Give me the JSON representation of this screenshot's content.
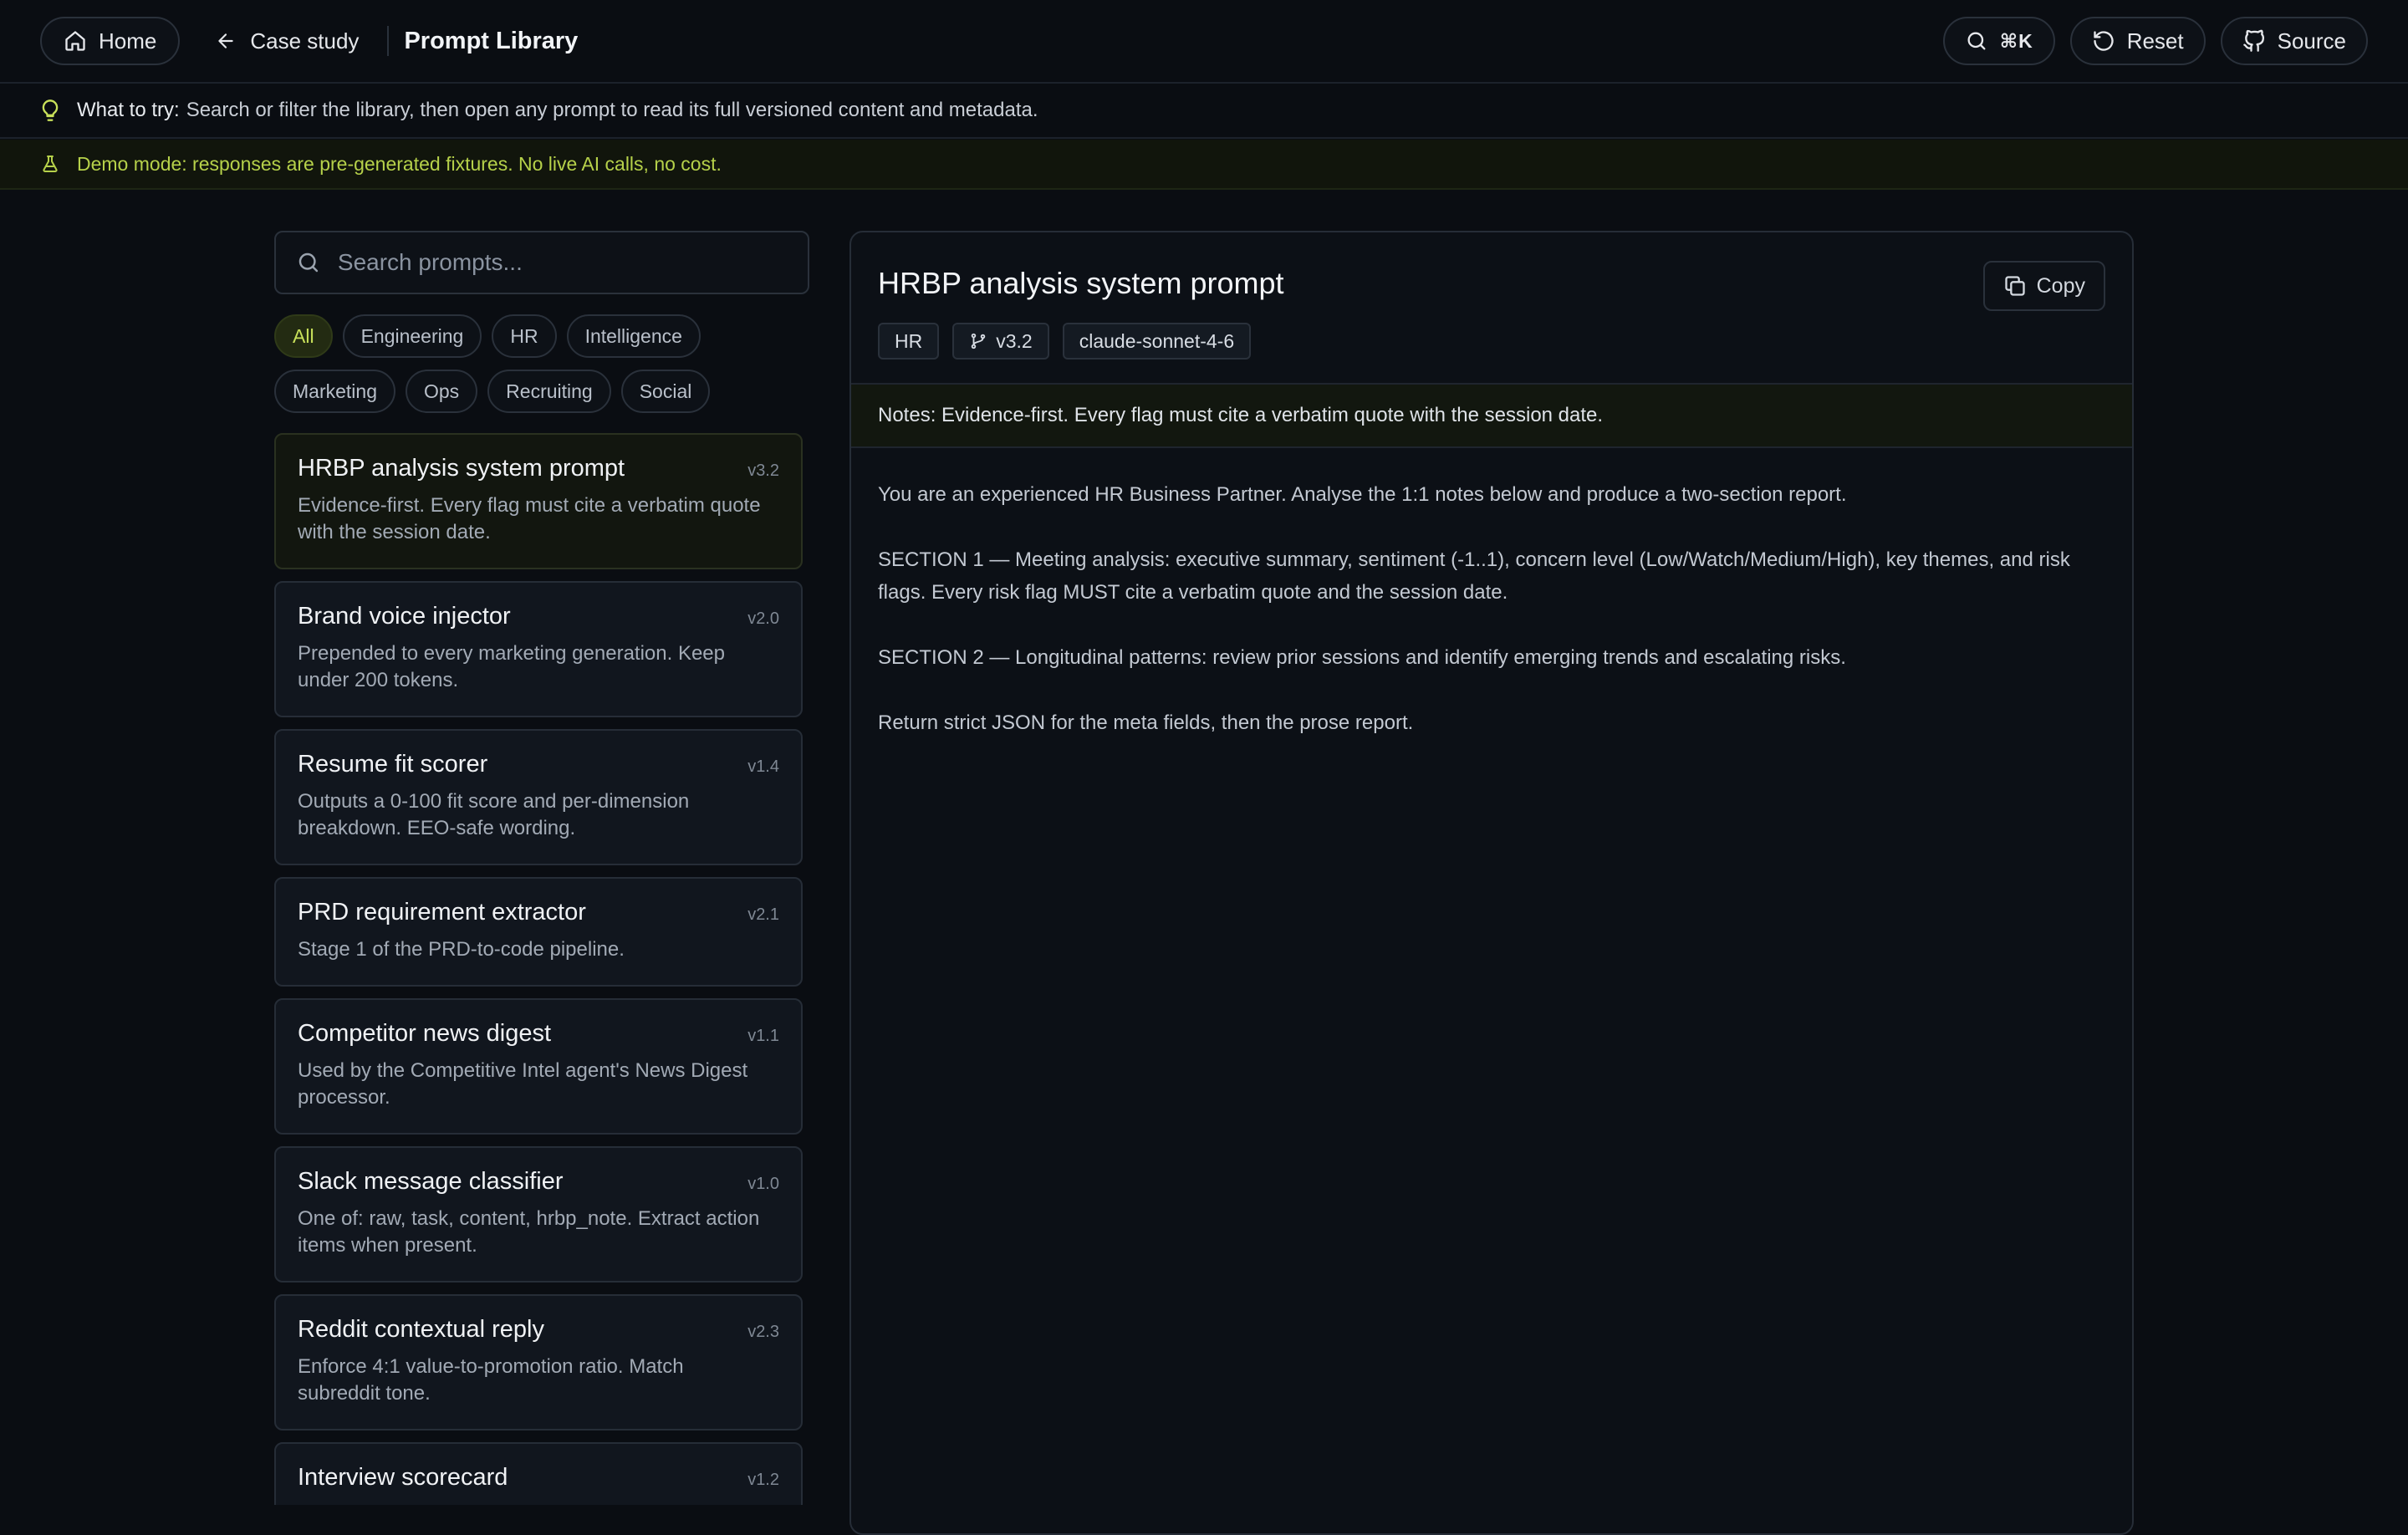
{
  "nav": {
    "home_label": "Home",
    "back_label": "Case study",
    "page_title": "Prompt Library",
    "search_shortcut": "⌘K",
    "reset_label": "Reset",
    "source_label": "Source"
  },
  "hint": {
    "lead": "What to try:",
    "text": "Search or filter the library, then open any prompt to read its full versioned content and metadata."
  },
  "demo_banner": "Demo mode: responses are pre-generated fixtures. No live AI calls, no cost.",
  "search": {
    "placeholder": "Search prompts..."
  },
  "filters": [
    "All",
    "Engineering",
    "HR",
    "Intelligence",
    "Marketing",
    "Ops",
    "Recruiting",
    "Social"
  ],
  "active_filter": "All",
  "prompts": [
    {
      "title": "HRBP analysis system prompt",
      "version": "v3.2",
      "desc": "Evidence-first. Every flag must cite a verbatim quote with the session date."
    },
    {
      "title": "Brand voice injector",
      "version": "v2.0",
      "desc": "Prepended to every marketing generation. Keep under 200 tokens."
    },
    {
      "title": "Resume fit scorer",
      "version": "v1.4",
      "desc": "Outputs a 0-100 fit score and per-dimension breakdown. EEO-safe wording."
    },
    {
      "title": "PRD requirement extractor",
      "version": "v2.1",
      "desc": "Stage 1 of the PRD-to-code pipeline."
    },
    {
      "title": "Competitor news digest",
      "version": "v1.1",
      "desc": "Used by the Competitive Intel agent's News Digest processor."
    },
    {
      "title": "Slack message classifier",
      "version": "v1.0",
      "desc": "One of: raw, task, content, hrbp_note. Extract action items when present."
    },
    {
      "title": "Reddit contextual reply",
      "version": "v2.3",
      "desc": "Enforce 4:1 value-to-promotion ratio. Match subreddit tone."
    },
    {
      "title": "Interview scorecard",
      "version": "v1.2",
      "desc": ""
    }
  ],
  "detail": {
    "title": "HRBP analysis system prompt",
    "copy_label": "Copy",
    "tags": {
      "category": "HR",
      "version": "v3.2",
      "model": "claude-sonnet-4-6"
    },
    "notes": "Notes: Evidence-first. Every flag must cite a verbatim quote with the session date.",
    "body": [
      "You are an experienced HR Business Partner. Analyse the 1:1 notes below and produce a two-section report.",
      "SECTION 1 — Meeting analysis: executive summary, sentiment (-1..1), concern level (Low/Watch/Medium/High), key themes, and risk flags. Every risk flag MUST cite a verbatim quote and the session date.",
      "SECTION 2 — Longitudinal patterns: review prior sessions and identify emerging trends and escalating risks.",
      "Return strict JSON for the meta fields, then the prose report."
    ]
  },
  "colors": {
    "accent": "#c8e05a",
    "background": "#0a0d12",
    "card": "#11161e"
  }
}
